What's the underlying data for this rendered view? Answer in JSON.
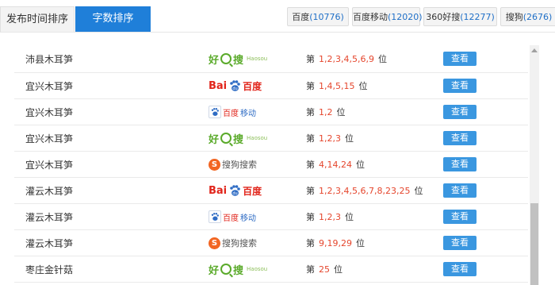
{
  "tabs": [
    {
      "label": "发布时间排序",
      "active": false
    },
    {
      "label": "字数排序",
      "active": true
    }
  ],
  "engines": [
    {
      "name": "百度",
      "count": "(10776)"
    },
    {
      "name": "百度移动",
      "count": "(12020)"
    },
    {
      "name": "360好搜",
      "count": "(12277)"
    },
    {
      "name": "搜狗",
      "count": "(2676)"
    }
  ],
  "logos": {
    "haosou": {
      "hao": "好",
      "sou": "搜",
      "en": "Haosou"
    },
    "baidu": {
      "bai": "Bai",
      "du": "百度"
    },
    "baidum": {
      "t1": "百度",
      "t2": "移动"
    },
    "sogou": {
      "s": "S",
      "t": "搜狗搜索"
    }
  },
  "rank_prefix": "第",
  "rank_suffix": "位",
  "view_label": "查看",
  "rows": [
    {
      "keyword": "沛县木耳笋",
      "engine": "haosou",
      "positions": "1,2,3,4,5,6,9"
    },
    {
      "keyword": "宜兴木耳笋",
      "engine": "baidu",
      "positions": "1,4,5,15"
    },
    {
      "keyword": "宜兴木耳笋",
      "engine": "baidum",
      "positions": "1,2"
    },
    {
      "keyword": "宜兴木耳笋",
      "engine": "haosou",
      "positions": "1,2,3"
    },
    {
      "keyword": "宜兴木耳笋",
      "engine": "sogou",
      "positions": "4,14,24"
    },
    {
      "keyword": "灌云木耳笋",
      "engine": "baidu",
      "positions": "1,2,3,4,5,6,7,8,23,25"
    },
    {
      "keyword": "灌云木耳笋",
      "engine": "baidum",
      "positions": "1,2,3"
    },
    {
      "keyword": "灌云木耳笋",
      "engine": "sogou",
      "positions": "9,19,29"
    },
    {
      "keyword": "枣庄金针菇",
      "engine": "haosou",
      "positions": "25"
    }
  ],
  "colors": {
    "tab_active": "#1f7fd9",
    "view_button": "#3a97e0",
    "rank_number": "#e5462d",
    "count_text": "#1f6fc7"
  }
}
